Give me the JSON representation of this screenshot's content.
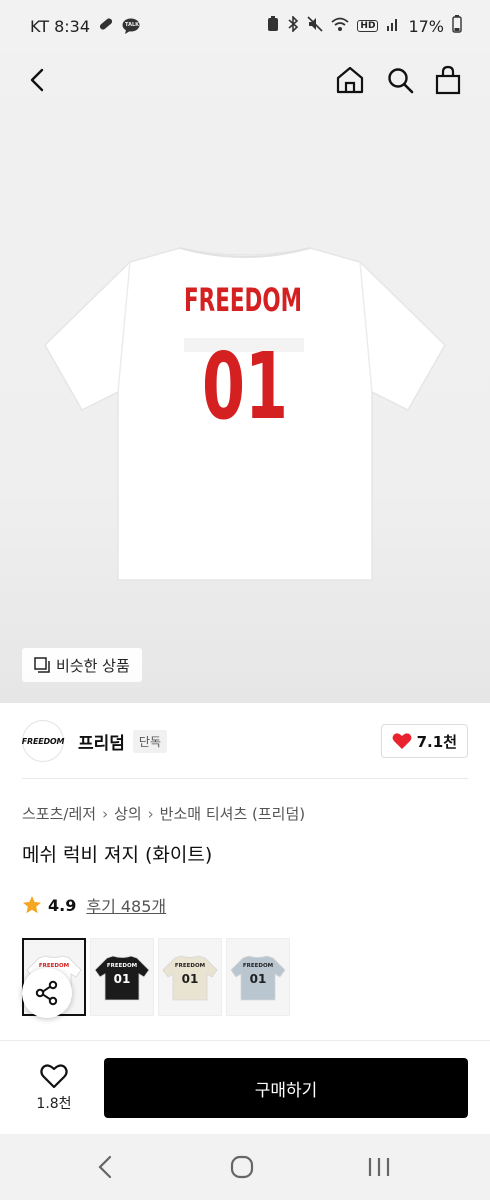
{
  "status_bar": {
    "carrier_time": "KT 8:34",
    "kakao_badge": "TALK",
    "hd_badge": "HD",
    "battery": "17%"
  },
  "top_nav": {
    "back_icon": "chevron-left-icon",
    "home_icon": "home-icon",
    "search_icon": "search-icon",
    "cart_icon": "shopping-bag-icon"
  },
  "product_image": {
    "shirt_text": "FREEDOM",
    "shirt_number": "01",
    "shirt_color": "#ffffff",
    "print_color": "#d42021"
  },
  "similar_button": {
    "label": "비슷한 상품"
  },
  "brand": {
    "logo_text": "FREEDOM",
    "name": "프리덤",
    "badge": "단독",
    "like_count": "7.1천",
    "heart_color": "#e8232d"
  },
  "breadcrumb": [
    "스포츠/레저",
    "상의",
    "반소매 티셔츠 (프리덤)"
  ],
  "product": {
    "title": "메쉬 럭비 져지 (화이트)",
    "rating": "4.9",
    "reviews": "후기 485개",
    "star_color": "#f5a623"
  },
  "color_options": [
    {
      "color": "#ffffff",
      "print": "#d42021",
      "text": "FREEDOM",
      "number": "01",
      "selected": true
    },
    {
      "color": "#1b1b1b",
      "print": "#ffffff",
      "text": "FREEDOM",
      "number": "01",
      "selected": false
    },
    {
      "color": "#e9e3d2",
      "print": "#1f1f1f",
      "text": "FREEDOM",
      "number": "01",
      "selected": false
    },
    {
      "color": "#b9c6cf",
      "print": "#1f1f1f",
      "text": "FREEDOM",
      "number": "01",
      "selected": false
    }
  ],
  "bottom_bar": {
    "wish_count": "1.8천",
    "buy_label": "구매하기"
  },
  "system_nav": {
    "back": "back-icon",
    "home": "home-circle-icon",
    "recents": "recents-icon"
  }
}
